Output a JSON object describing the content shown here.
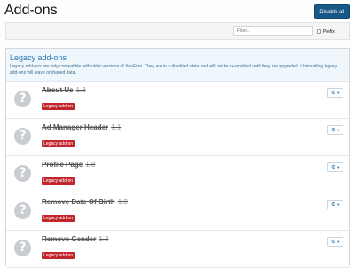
{
  "header": {
    "title": "Add-ons",
    "disable_all_label": "Disable all"
  },
  "filter": {
    "placeholder": "Filter...",
    "prefix_label": "Prefix"
  },
  "section": {
    "title": "Legacy add-ons",
    "description": "Legacy add-ons are only compatible with older versions of XenForo. They are in a disabled state and will not be re-enabled until they are upgraded. Uninstalling legacy add-ons will leave orphaned data."
  },
  "addons": [
    {
      "title": "About Us",
      "version": "1.3",
      "badge": "Legacy add-on"
    },
    {
      "title": "Ad Manager Header",
      "version": "1.1",
      "badge": "Legacy add-on"
    },
    {
      "title": "Profile Page",
      "version": "1.8",
      "badge": "Legacy add-on"
    },
    {
      "title": "Remove Date Of Birth",
      "version": "1.3",
      "badge": "Legacy add-on"
    },
    {
      "title": "Remove Gender",
      "version": "1.3",
      "badge": "Legacy add-on"
    }
  ],
  "colors": {
    "primary_button": "#185886",
    "section_title": "#2577b1",
    "legacy_badge": "#c0262c",
    "addon_icon": "#c9ccd0"
  },
  "icons": {
    "addon_icon": "question-mark-icon",
    "options_icon": "gear-icon",
    "dropdown_icon": "caret-down-icon"
  }
}
